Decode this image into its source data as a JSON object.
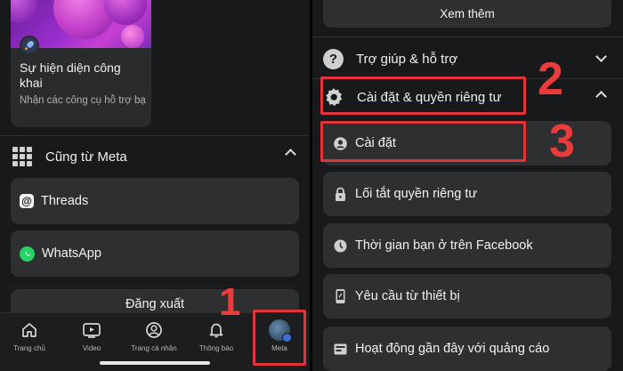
{
  "left": {
    "card": {
      "title": "Sự hiện diện công khai",
      "description": "Nhận các công cụ hỗ trợ bạn phát triển trên Fac..."
    },
    "section_title": "Cũng từ Meta",
    "apps": [
      {
        "label": "Threads",
        "icon": "threads-icon"
      },
      {
        "label": "WhatsApp",
        "icon": "whatsapp-icon"
      }
    ],
    "logout_label": "Đăng xuất",
    "tabs": [
      {
        "label": "Trang chủ",
        "icon": "home-icon"
      },
      {
        "label": "Video",
        "icon": "video-icon"
      },
      {
        "label": "Trang cá nhân",
        "icon": "profile-icon"
      },
      {
        "label": "Thông báo",
        "icon": "bell-icon"
      },
      {
        "label": "Meta",
        "icon": "meta-avatar"
      }
    ]
  },
  "right": {
    "see_more_label": "Xem thêm",
    "help_label": "Trợ giúp & hỗ trợ",
    "settings_privacy_label": "Cài đặt & quyền riêng tư",
    "items": [
      {
        "label": "Cài đặt",
        "icon": "person-circle-icon"
      },
      {
        "label": "Lối tắt quyền riêng tư",
        "icon": "lock-icon"
      },
      {
        "label": "Thời gian bạn ở trên Facebook",
        "icon": "clock-icon"
      },
      {
        "label": "Yêu cầu từ thiết bị",
        "icon": "phone-icon"
      },
      {
        "label": "Hoạt động gần đây với quảng cáo",
        "icon": "ad-activity-icon"
      }
    ]
  },
  "annotations": {
    "step1": "1",
    "step2": "2",
    "step3": "3"
  },
  "colors": {
    "annotation_red": "#e0343a",
    "background": "#18191a",
    "row_bg": "#2e2f31"
  }
}
